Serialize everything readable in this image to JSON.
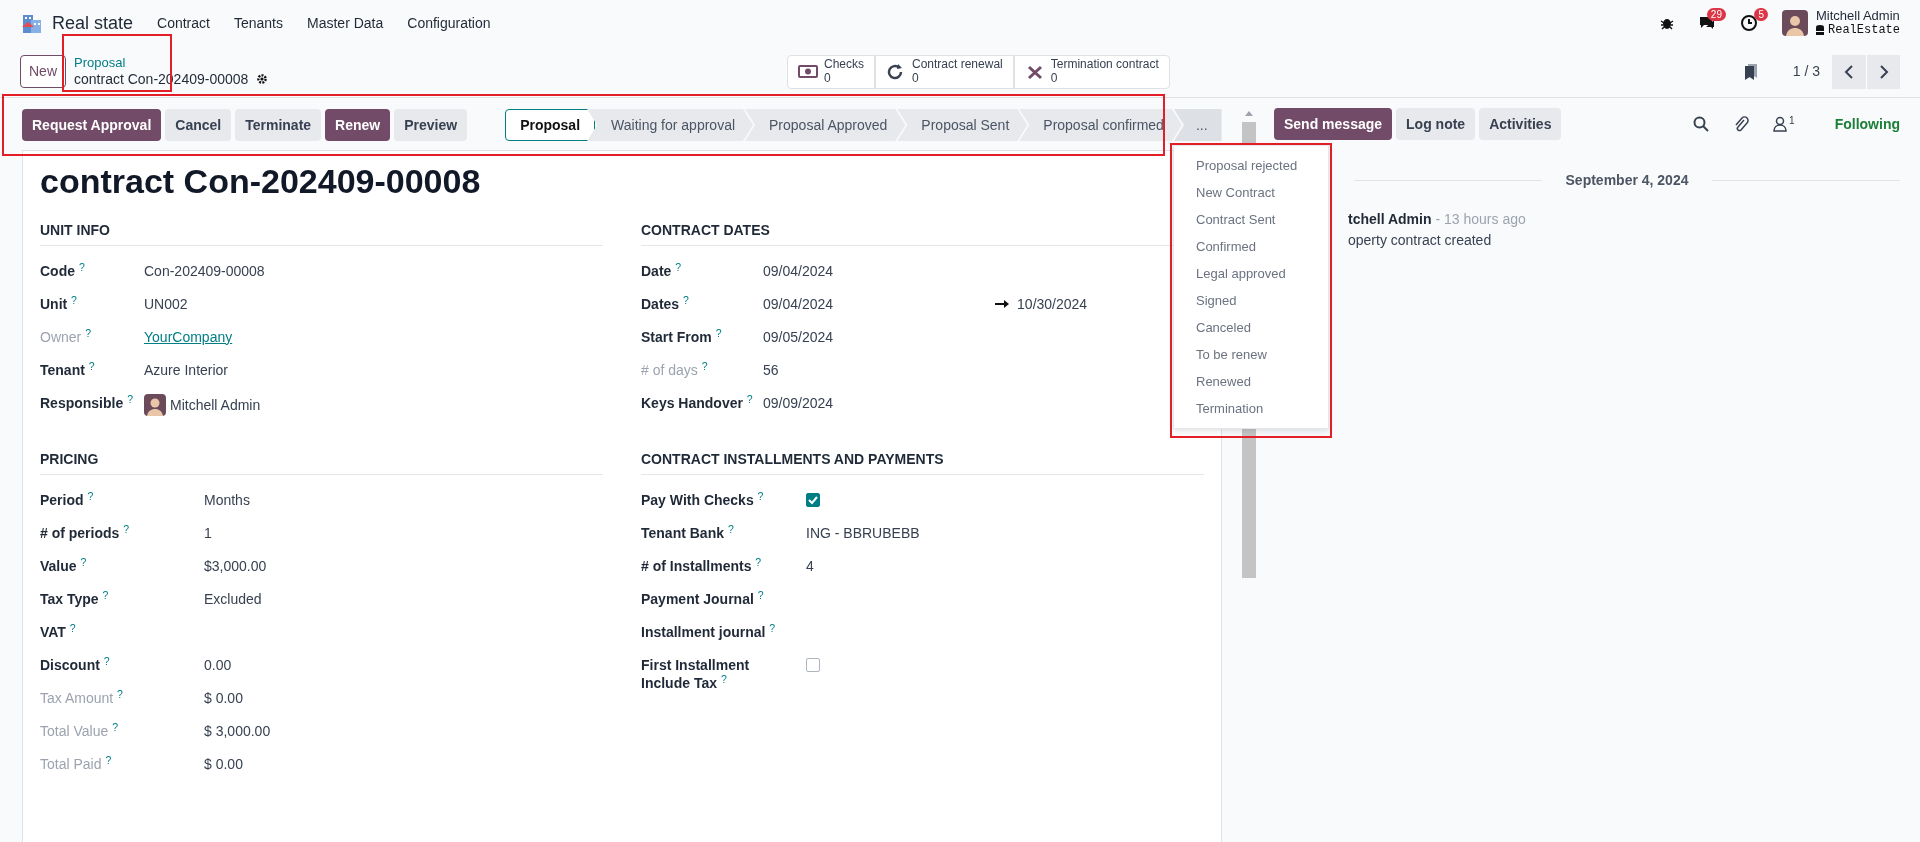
{
  "app": {
    "name": "Real state",
    "menus": [
      "Contract",
      "Tenants",
      "Master Data",
      "Configuration"
    ]
  },
  "systray": {
    "messages_badge": "29",
    "activities_badge": "5",
    "user_name": "Mitchell Admin",
    "database": "RealEstate"
  },
  "control_panel": {
    "new_button": "New",
    "breadcrumb_parent": "Proposal",
    "breadcrumb_current": "contract Con-202409-00008",
    "stat_buttons": [
      {
        "kind": "checks",
        "label": "Checks",
        "value": "0"
      },
      {
        "kind": "renewal",
        "label": "Contract renewal",
        "value": "0"
      },
      {
        "kind": "termination",
        "label": "Termination contract",
        "value": "0"
      }
    ],
    "pager": "1 / 3"
  },
  "actions": [
    {
      "label": "Request Approval",
      "primary": true
    },
    {
      "label": "Cancel",
      "primary": false
    },
    {
      "label": "Terminate",
      "primary": false
    },
    {
      "label": "Renew",
      "primary": true
    },
    {
      "label": "Preview",
      "primary": false
    }
  ],
  "statusbar": {
    "steps": [
      {
        "label": "Proposal",
        "selected": true
      },
      {
        "label": "Waiting for approval",
        "selected": false
      },
      {
        "label": "Proposal Approved",
        "selected": false
      },
      {
        "label": "Proposal Sent",
        "selected": false
      },
      {
        "label": "Proposal confirmed",
        "selected": false
      }
    ],
    "more": {
      "label": "...",
      "expanded": true,
      "items": [
        "Proposal rejected",
        "New Contract",
        "Contract Sent",
        "Confirmed",
        "Legal approved",
        "Signed",
        "Canceled",
        "To be renew",
        "Renewed",
        "Termination"
      ]
    }
  },
  "form": {
    "title": "contract Con-202409-00008",
    "columns": [
      [
        {
          "title": "UNIT INFO",
          "fields": [
            {
              "label": "Code $^{?}$",
              "kind": "text",
              "value": "Con-202409-00008",
              "muted": false
            },
            {
              "label": "Unit $^{?}$",
              "kind": "text",
              "value": "UN002",
              "muted": false
            },
            {
              "label": "Owner $^{?}$",
              "kind": "link",
              "value": "YourCompany",
              "muted": true
            },
            {
              "label": "Tenant $^{?}$",
              "kind": "text",
              "value": "Azure Interior",
              "muted": false
            },
            {
              "label": "Responsible $^{?}$",
              "kind": "avatar",
              "value": "Mitchell Admin",
              "muted": false
            }
          ]
        },
        {
          "title": "PRICING",
          "fields": [
            {
              "label": "Period $^{?}$",
              "kind": "text",
              "value": "Months",
              "muted": false
            },
            {
              "label": "# of periods $^{?}$",
              "kind": "text",
              "value": "1",
              "muted": false
            },
            {
              "label": "Value $^{?}$",
              "kind": "text",
              "value": "$3,000.00",
              "muted": false
            },
            {
              "label": "Tax Type $^{?}$",
              "kind": "text",
              "value": "Excluded",
              "muted": false
            },
            {
              "label": "VAT $^{?}$",
              "kind": "text",
              "muted": false
            },
            {
              "label": "Discount $^{?}$",
              "kind": "text",
              "value": "0.00",
              "muted": false
            },
            {
              "label": "Tax Amount $^{?}$",
              "kind": "text",
              "value": "$ 0.00",
              "muted": true
            },
            {
              "label": "Total Value $^{?}$",
              "kind": "text",
              "value": "$ 3,000.00",
              "muted": true
            },
            {
              "label": "Total Paid $^{?}$",
              "kind": "text",
              "value": "$ 0.00",
              "muted": true
            }
          ]
        }
      ],
      [
        {
          "title": "CONTRACT DATES",
          "fields": [
            {
              "label": "Date $^{?}$",
              "kind": "text",
              "value": "09/04/2024",
              "muted": false
            },
            {
              "label": "Dates $^{?}$",
              "kind": "range",
              "value": "09/04/2024",
              "end": "10/30/2024",
              "muted": false
            },
            {
              "label": "Start From $^{?}$",
              "kind": "text",
              "value": "09/05/2024",
              "muted": false
            },
            {
              "label": "# of days $^{?}$",
              "kind": "text",
              "value": "56",
              "muted": true
            },
            {
              "label": "Keys Handover $^{?}$",
              "kind": "text",
              "value": "09/09/2024",
              "muted": false
            }
          ]
        },
        {
          "title": "CONTRACT INSTALLMENTS AND PAYMENTS",
          "fields": [
            {
              "label": "Pay With Checks $^{?}$",
              "kind": "checkbox",
              "checked": true,
              "muted": false
            },
            {
              "label": "Tenant Bank $^{?}$",
              "kind": "text",
              "value": "ING - BBRUBEBB",
              "muted": false
            },
            {
              "label": "# of Installments $^{?}$",
              "kind": "text",
              "value": "4",
              "muted": false
            },
            {
              "label": "Payment Journal $^{?}$",
              "kind": "text",
              "muted": false
            },
            {
              "label": "Installment journal $^{?}$",
              "kind": "text",
              "muted": false
            },
            {
              "label": "First Installment Include Tax $^{?}$",
              "kind": "checkbox",
              "checked": false,
              "muted": false
            }
          ]
        }
      ]
    ]
  },
  "chatter": {
    "buttons": [
      {
        "label": "Send message",
        "primary": true
      },
      {
        "label": "Log note",
        "primary": false
      },
      {
        "label": "Activities",
        "primary": false
      }
    ],
    "followers_count": "1",
    "follow_label": "Following",
    "date": "September 4, 2024",
    "messages": [
      {
        "author": "tchell Admin",
        "time": "- 13 hours ago",
        "body": "operty contract created"
      }
    ]
  }
}
